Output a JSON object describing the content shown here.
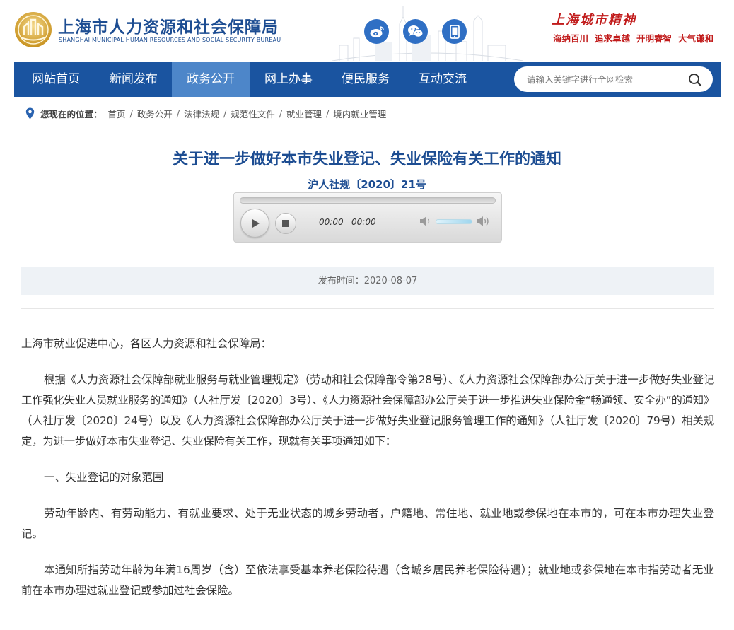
{
  "header": {
    "bureau_name": "上海市人力资源和社会保障局",
    "bureau_name_en": "SHANGHAI MUNICIPAL HUMAN RESOURCES AND SOCIAL SECURITY BUREAU",
    "social_icons": [
      "weibo-icon",
      "wechat-icon",
      "mobile-icon"
    ],
    "spirit_title": "上海城市精神",
    "spirit_mottos": [
      "海纳百川",
      "追求卓越",
      "开明睿智",
      "大气谦和"
    ]
  },
  "nav": {
    "items": [
      "网站首页",
      "新闻发布",
      "政务公开",
      "网上办事",
      "便民服务",
      "互动交流"
    ],
    "active_index": 2,
    "search_placeholder": "请输入关键字进行全网检索"
  },
  "breadcrumb": {
    "lead": "您现在的位置：",
    "items": [
      "首页",
      "政务公开",
      "法律法规",
      "规范性文件",
      "就业管理",
      "境内就业管理"
    ]
  },
  "article": {
    "title": "关于进一步做好本市失业登记、失业保险有关工作的通知",
    "doc_number": "沪人社规〔2020〕21号",
    "publish_label": "发布时间：",
    "publish_date": "2020-08-07",
    "salutation": "上海市就业促进中心，各区人力资源和社会保障局：",
    "paragraphs": [
      "根据《人力资源社会保障部就业服务与就业管理规定》（劳动和社会保障部令第28号）、《人力资源社会保障部办公厅关于进一步做好失业登记工作强化失业人员就业服务的通知》（人社厅发〔2020〕3号）、《人力资源社会保障部办公厅关于进一步推进失业保险金“畅通领、安全办”的通知》（人社厅发〔2020〕24号）以及《人力资源社会保障部办公厅关于进一步做好失业登记服务管理工作的通知》（人社厅发〔2020〕79号）相关规定，为进一步做好本市失业登记、失业保险有关工作，现就有关事项通知如下：",
      "一、失业登记的对象范围",
      "劳动年龄内、有劳动能力、有就业要求、处于无业状态的城乡劳动者，户籍地、常住地、就业地或参保地在本市的，可在本市办理失业登记。",
      "本通知所指劳动年龄为年满16周岁（含）至依法享受基本养老保险待遇（含城乡居民养老保险待遇）；就业地或参保地在本市指劳动者无业前在本市办理过就业登记或参加过社会保险。"
    ]
  },
  "player": {
    "current_time": "00:00",
    "duration": "00:00",
    "volume": 0.75
  },
  "colors": {
    "brand_blue": "#1d4d92",
    "nav_bg": "#1a54a0",
    "nav_active": "#4d86c9",
    "spirit_red": "#c11b1b"
  }
}
